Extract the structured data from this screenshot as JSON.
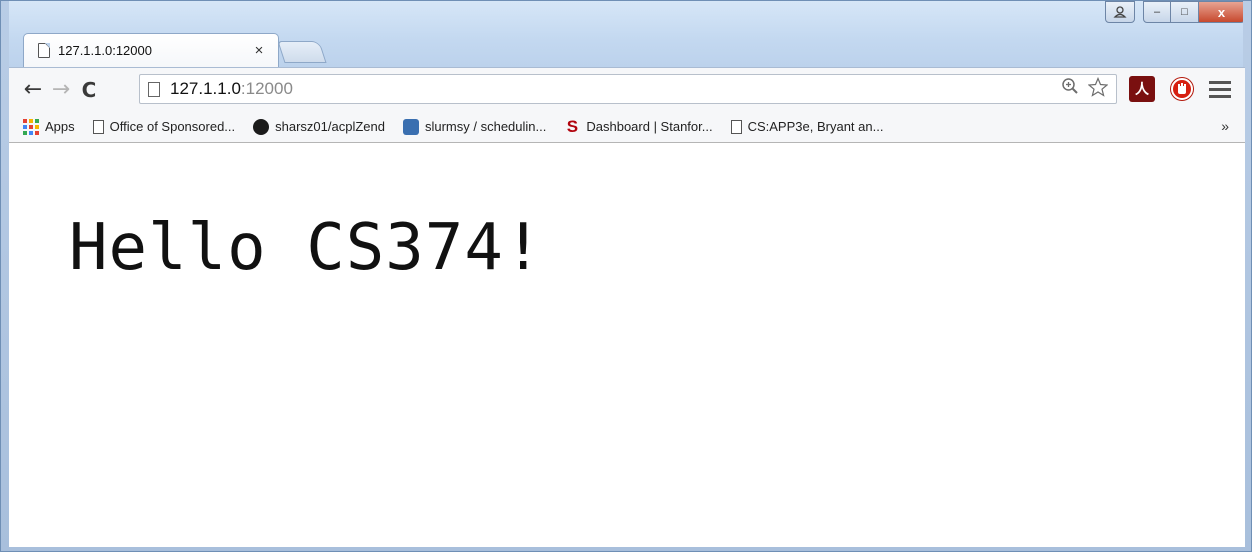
{
  "tab": {
    "title": "127.1.1.0:12000",
    "close_glyph": "×"
  },
  "window_controls": {
    "minimize": "–",
    "maximize": "□",
    "close": "x"
  },
  "toolbar": {
    "back_glyph": "←",
    "forward_glyph": "→",
    "reload_glyph": "C",
    "url_host": "127.1.1.0",
    "url_port": ":12000",
    "acrobat_glyph": "人"
  },
  "bookmarks": {
    "items": [
      {
        "label": "Apps",
        "icon": "apps-icon"
      },
      {
        "label": "Office of Sponsored...",
        "icon": "page-icon"
      },
      {
        "label": "sharsz01/acplZend",
        "icon": "github-icon"
      },
      {
        "label": "slurmsy / schedulin...",
        "icon": "database-icon"
      },
      {
        "label": "Dashboard | Stanfor...",
        "icon": "stanford-icon"
      },
      {
        "label": "CS:APP3e, Bryant an...",
        "icon": "page-icon"
      }
    ],
    "more": "»"
  },
  "page": {
    "heading": "Hello CS374!"
  },
  "colors": {
    "frame": "#c9dcf2",
    "stanford_red": "#b1040e",
    "acrobat": "#7a1010",
    "stop_red": "#d61f10"
  }
}
